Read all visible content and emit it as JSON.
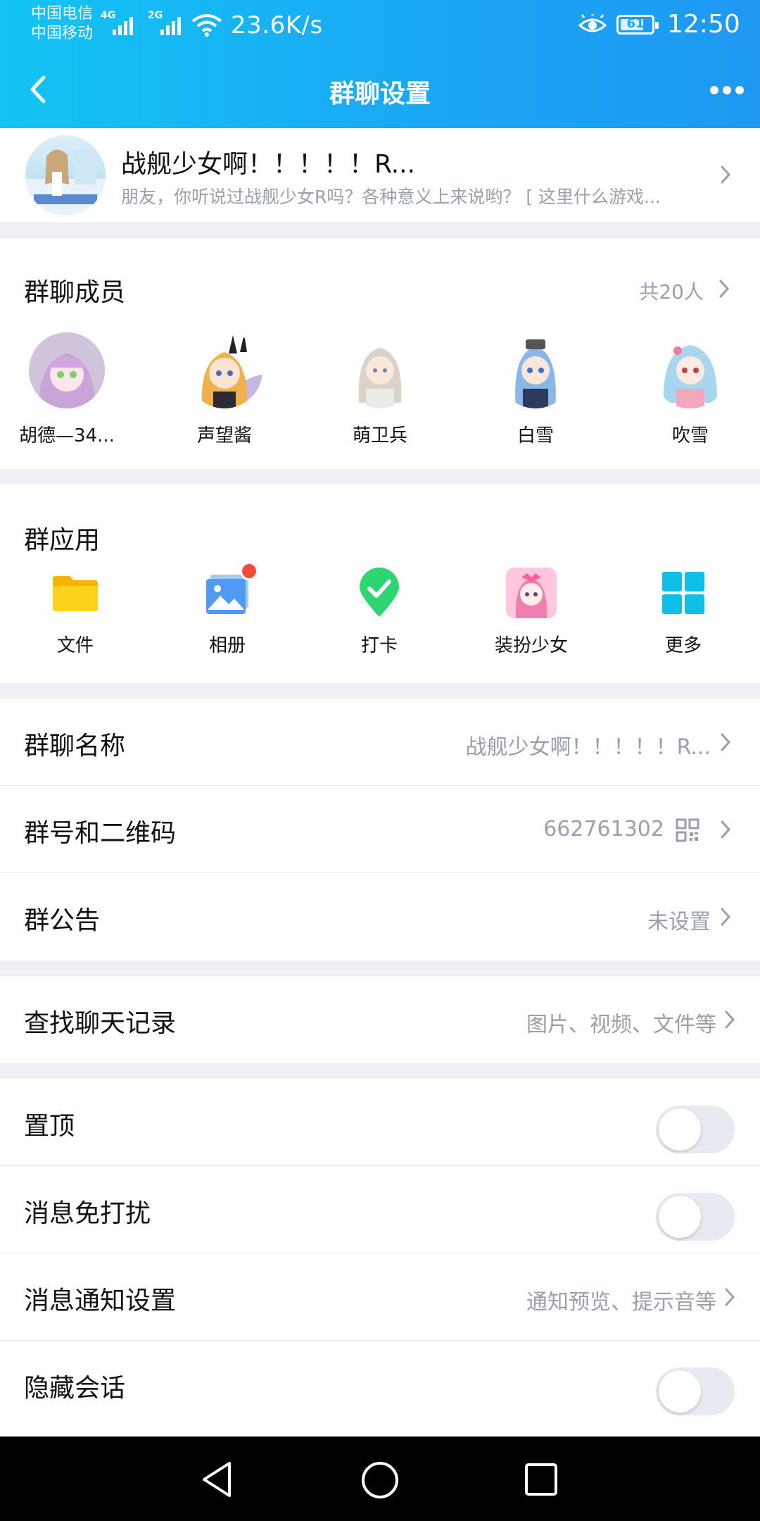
{
  "status_bar": {
    "carrier1": "中国电信",
    "carrier2": "中国移动",
    "sig1_tag": "4G",
    "sig2_tag": "2G",
    "net_speed": "23.6K/s",
    "battery": "61",
    "time": "12:50"
  },
  "nav": {
    "title": "群聊设置"
  },
  "group_header": {
    "name": "战舰少女啊！！！！！R...",
    "desc": "朋友，你听说过战舰少女R吗？各种意义上来说哟？ [ 这里什么游戏..."
  },
  "members": {
    "title": "群聊成员",
    "count": "共20人",
    "list": [
      {
        "name": "胡德—34..."
      },
      {
        "name": "声望酱"
      },
      {
        "name": "萌卫兵"
      },
      {
        "name": "白雪"
      },
      {
        "name": "吹雪"
      }
    ]
  },
  "apps": {
    "title": "群应用",
    "items": [
      {
        "label": "文件",
        "icon": "folder-icon"
      },
      {
        "label": "相册",
        "icon": "photo-album-icon"
      },
      {
        "label": "打卡",
        "icon": "check-in-icon"
      },
      {
        "label": "装扮少女",
        "icon": "dress-up-girl-icon"
      },
      {
        "label": "更多",
        "icon": "more-grid-icon"
      }
    ]
  },
  "info_rows": {
    "group_name": {
      "label": "群聊名称",
      "value": "战舰少女啊！！！！！R..."
    },
    "group_id": {
      "label": "群号和二维码",
      "value": "662761302"
    },
    "notice": {
      "label": "群公告",
      "value": "未设置"
    }
  },
  "search_history": {
    "label": "查找聊天记录",
    "value": "图片、视频、文件等"
  },
  "settings": {
    "pin": {
      "label": "置顶",
      "on": false
    },
    "dnd": {
      "label": "消息免打扰",
      "on": false
    },
    "notify": {
      "label": "消息通知设置",
      "value": "通知预览、提示音等"
    },
    "hide": {
      "label": "隐藏会话",
      "on": false
    }
  },
  "colors": {
    "header_start": "#13c4f4",
    "header_end": "#1e98f3",
    "badge": "#f24a3d"
  }
}
